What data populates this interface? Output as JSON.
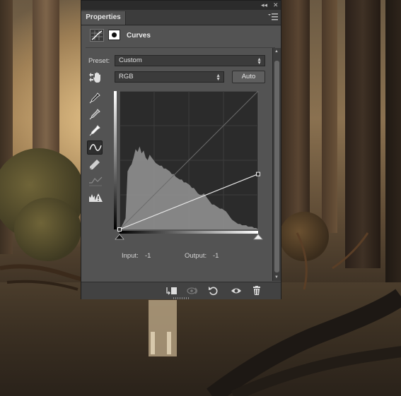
{
  "panel": {
    "tab_label": "Properties",
    "adjustment_title": "Curves",
    "preset_label": "Preset:",
    "preset_value": "Custom",
    "channel_value": "RGB",
    "auto_label": "Auto",
    "input_label": "Input:",
    "input_value": "-1",
    "output_label": "Output:",
    "output_value": "-1"
  },
  "curve": {
    "points": [
      [
        0,
        0
      ],
      [
        255,
        102
      ]
    ],
    "histogram": [
      0.0,
      0.02,
      0.05,
      0.08,
      0.42,
      0.45,
      0.47,
      0.52,
      0.58,
      0.56,
      0.6,
      0.55,
      0.57,
      0.52,
      0.5,
      0.54,
      0.52,
      0.5,
      0.48,
      0.47,
      0.46,
      0.46,
      0.44,
      0.44,
      0.43,
      0.42,
      0.4,
      0.4,
      0.38,
      0.37,
      0.36,
      0.36,
      0.34,
      0.34,
      0.33,
      0.32,
      0.3,
      0.3,
      0.28,
      0.26,
      0.25,
      0.25,
      0.26,
      0.24,
      0.22,
      0.2,
      0.18,
      0.18,
      0.17,
      0.16,
      0.15,
      0.15,
      0.14,
      0.13,
      0.11,
      0.09,
      0.07,
      0.06,
      0.05,
      0.04,
      0.04,
      0.03,
      0.03,
      0.03,
      0.02,
      0.02,
      0.02,
      0.01,
      0.01,
      0.0
    ],
    "colors": {
      "histogram": "#8a8a8a",
      "curve": "#e8e8e8",
      "grid": "#3d3d3d",
      "background": "#2b2b2b"
    }
  },
  "icons": {
    "tools": [
      "targeted-adjustment-hand-icon",
      "black-point-eyedropper-icon",
      "gray-point-eyedropper-icon",
      "white-point-eyedropper-icon",
      "edit-points-curve-icon",
      "pencil-draw-icon",
      "smooth-curve-icon",
      "clipping-warning-icon"
    ],
    "bottom": [
      "clip-to-layer-icon",
      "view-previous-state-icon",
      "reset-icon",
      "visibility-eye-icon",
      "trash-icon"
    ]
  }
}
